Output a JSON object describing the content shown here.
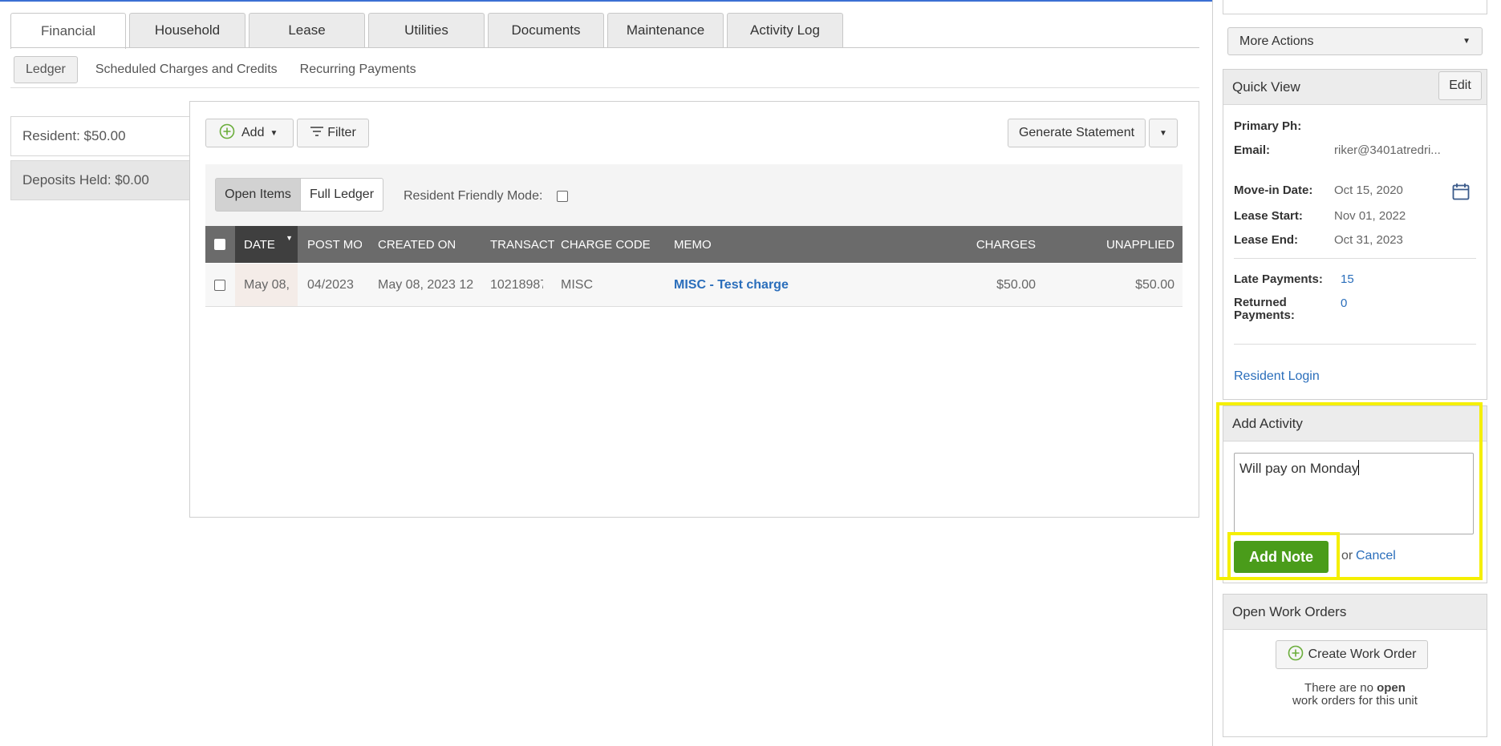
{
  "tabs": [
    "Financial",
    "Household",
    "Lease",
    "Utilities",
    "Documents",
    "Maintenance",
    "Activity Log"
  ],
  "subtabs": [
    "Ledger",
    "Scheduled Charges and Credits",
    "Recurring Payments"
  ],
  "balances": {
    "resident": "Resident: $50.00",
    "deposits": "Deposits Held: $0.00"
  },
  "toolbar": {
    "add": "Add",
    "filter": "Filter",
    "generate": "Generate Statement"
  },
  "view": {
    "open_items": "Open Items",
    "full_ledger": "Full Ledger",
    "resident_friendly": "Resident Friendly Mode:"
  },
  "table": {
    "headers": {
      "date": "DATE",
      "post_month": "POST MO",
      "created_on": "CREATED ON",
      "transaction": "TRANSACT",
      "charge_code": "CHARGE CODE",
      "memo": "MEMO",
      "charges": "CHARGES",
      "unapplied": "UNAPPLIED"
    },
    "rows": [
      {
        "date": "May 08,",
        "post_month": "04/2023",
        "created_on": "May 08, 2023 12",
        "transaction": "10218987",
        "charge_code": "MISC",
        "memo": "MISC - Test charge",
        "charges": "$50.00",
        "unapplied": "$50.00"
      }
    ]
  },
  "sidebar": {
    "more_actions": "More Actions",
    "quick_view": {
      "title": "Quick View",
      "edit": "Edit",
      "primary_ph_label": "Primary Ph:",
      "email_label": "Email:",
      "email": "riker@3401atredri...",
      "move_in_label": "Move-in Date:",
      "move_in": "Oct 15, 2020",
      "lease_start_label": "Lease Start:",
      "lease_start": "Nov 01, 2022",
      "lease_end_label": "Lease End:",
      "lease_end": "Oct 31, 2023",
      "late_payments_label": "Late Payments:",
      "late_payments": "15",
      "returned_label_1": "Returned",
      "returned_label_2": "Payments:",
      "returned": "0",
      "resident_login": "Resident Login"
    },
    "add_activity": {
      "title": "Add Activity",
      "note_text": "Will pay on Monday",
      "add_note": "Add Note",
      "or": "or",
      "cancel": "Cancel"
    },
    "work_orders": {
      "title": "Open Work Orders",
      "create": "Create Work Order",
      "empty_1a": "There are no ",
      "empty_1b": "open",
      "empty_2": "work orders for this unit"
    }
  },
  "colors": {
    "accent_link": "#2a6ebb",
    "add_note_green": "#4a9c1a",
    "highlight": "#f5ef00",
    "header_gray": "#6b6b6b"
  }
}
